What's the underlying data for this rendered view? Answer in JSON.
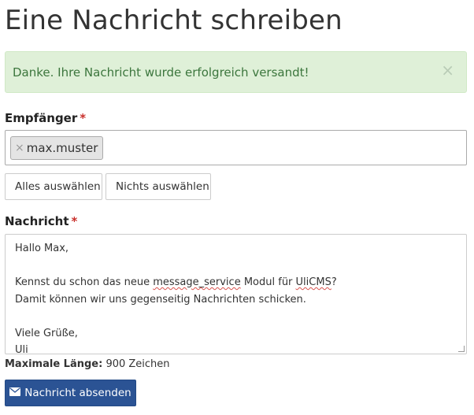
{
  "page": {
    "title": "Eine Nachricht schreiben"
  },
  "alert": {
    "text": "Danke. Ihre Nachricht wurde erfolgreich versandt!",
    "close_glyph": "×"
  },
  "recipients": {
    "label": "Empfänger",
    "required_mark": "*",
    "selected": [
      {
        "name": "max.muster",
        "remove_glyph": "×"
      }
    ],
    "select_all_label": "Alles auswählen",
    "select_none_label": "Nichts auswählen"
  },
  "message": {
    "label": "Nachricht",
    "required_mark": "*",
    "lines": [
      "Hallo Max,",
      "",
      "Kennst du schon das neue ",
      "message_service",
      " Modul für ",
      "UliCMS",
      "?",
      "Damit können wir uns gegenseitig Nachrichten schicken.",
      "",
      "Viele Grüße,",
      "Uli"
    ],
    "maxlength_label": "Maximale Länge:",
    "maxlength_value": "900 Zeichen"
  },
  "submit": {
    "label": "Nachricht absenden",
    "icon": "envelope-icon"
  },
  "colors": {
    "alert_bg": "#dff0d8",
    "alert_text": "#3c763d",
    "required": "#c9302c",
    "primary": "#2b5394"
  }
}
